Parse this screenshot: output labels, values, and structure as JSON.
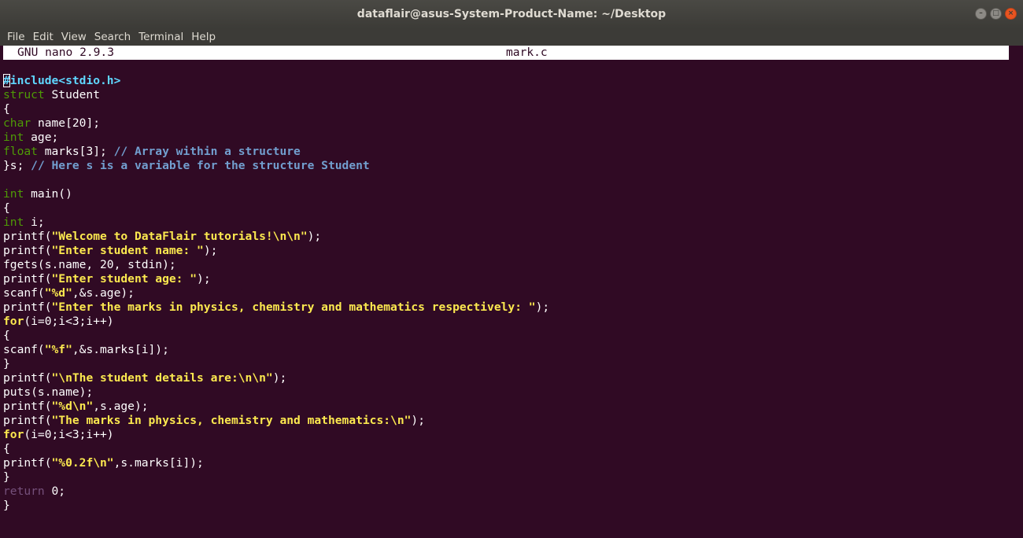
{
  "window": {
    "title": "dataflair@asus-System-Product-Name: ~/Desktop",
    "controls": {
      "minimize": "–",
      "maximize": "□",
      "close": "×"
    }
  },
  "menu": {
    "items": [
      "File",
      "Edit",
      "View",
      "Search",
      "Terminal",
      "Help"
    ]
  },
  "nano": {
    "version": "GNU nano 2.9.3",
    "filename": "mark.c"
  },
  "colors": {
    "terminal_background": "#300a24",
    "titlebar": "#3c3b37",
    "keyword": "#4e9a06",
    "preprocessor": "#5fd7ff",
    "comment": "#729fcf",
    "string": "#fce94f",
    "close_button": "#e95420"
  },
  "code": {
    "lines": [
      [
        {
          "t": "#",
          "c": "cursor-pre"
        },
        {
          "t": "include<stdio.h>",
          "c": "pre"
        }
      ],
      [
        {
          "t": "struct",
          "c": "keyword"
        },
        {
          "t": " Student",
          "c": "plain"
        }
      ],
      [
        {
          "t": "{",
          "c": "plain"
        }
      ],
      [
        {
          "t": "char",
          "c": "keyword"
        },
        {
          "t": " name[20];",
          "c": "plain"
        }
      ],
      [
        {
          "t": "int",
          "c": "keyword"
        },
        {
          "t": " age;",
          "c": "plain"
        }
      ],
      [
        {
          "t": "float",
          "c": "keyword"
        },
        {
          "t": " marks[3]; ",
          "c": "plain"
        },
        {
          "t": "// Array within a structure",
          "c": "comment"
        }
      ],
      [
        {
          "t": "}s; ",
          "c": "plain"
        },
        {
          "t": "// Here s is a variable for the structure Student",
          "c": "comment"
        }
      ],
      [],
      [
        {
          "t": "int",
          "c": "keyword"
        },
        {
          "t": " main()",
          "c": "plain"
        }
      ],
      [
        {
          "t": "{",
          "c": "plain"
        }
      ],
      [
        {
          "t": "int",
          "c": "keyword"
        },
        {
          "t": " i;",
          "c": "plain"
        }
      ],
      [
        {
          "t": "printf(",
          "c": "plain"
        },
        {
          "t": "\"Welcome to DataFlair tutorials!\\n\\n\"",
          "c": "string"
        },
        {
          "t": ");",
          "c": "plain"
        }
      ],
      [
        {
          "t": "printf(",
          "c": "plain"
        },
        {
          "t": "\"Enter student name: \"",
          "c": "string"
        },
        {
          "t": ");",
          "c": "plain"
        }
      ],
      [
        {
          "t": "fgets(s.name, 20, stdin);",
          "c": "plain"
        }
      ],
      [
        {
          "t": "printf(",
          "c": "plain"
        },
        {
          "t": "\"Enter student age: \"",
          "c": "string"
        },
        {
          "t": ");",
          "c": "plain"
        }
      ],
      [
        {
          "t": "scanf(",
          "c": "plain"
        },
        {
          "t": "\"%d\"",
          "c": "string"
        },
        {
          "t": ",&s.age);",
          "c": "plain"
        }
      ],
      [
        {
          "t": "printf(",
          "c": "plain"
        },
        {
          "t": "\"Enter the marks in physics, chemistry and mathematics respectively: \"",
          "c": "string"
        },
        {
          "t": ");",
          "c": "plain"
        }
      ],
      [
        {
          "t": "for",
          "c": "flow"
        },
        {
          "t": "(i=0;i<3;i++)",
          "c": "plain"
        }
      ],
      [
        {
          "t": "{",
          "c": "plain"
        }
      ],
      [
        {
          "t": "scanf(",
          "c": "plain"
        },
        {
          "t": "\"%f\"",
          "c": "string"
        },
        {
          "t": ",&s.marks[i]);",
          "c": "plain"
        }
      ],
      [
        {
          "t": "}",
          "c": "plain"
        }
      ],
      [
        {
          "t": "printf(",
          "c": "plain"
        },
        {
          "t": "\"\\nThe student details are:\\n\\n\"",
          "c": "string"
        },
        {
          "t": ");",
          "c": "plain"
        }
      ],
      [
        {
          "t": "puts(s.name);",
          "c": "plain"
        }
      ],
      [
        {
          "t": "printf(",
          "c": "plain"
        },
        {
          "t": "\"%d\\n\"",
          "c": "string"
        },
        {
          "t": ",s.age);",
          "c": "plain"
        }
      ],
      [
        {
          "t": "printf(",
          "c": "plain"
        },
        {
          "t": "\"The marks in physics, chemistry and mathematics:\\n\"",
          "c": "string"
        },
        {
          "t": ");",
          "c": "plain"
        }
      ],
      [
        {
          "t": "for",
          "c": "flow"
        },
        {
          "t": "(i=0;i<3;i++)",
          "c": "plain"
        }
      ],
      [
        {
          "t": "{",
          "c": "plain"
        }
      ],
      [
        {
          "t": "printf(",
          "c": "plain"
        },
        {
          "t": "\"%0.2f\\n\"",
          "c": "string"
        },
        {
          "t": ",s.marks[i]);",
          "c": "plain"
        }
      ],
      [
        {
          "t": "}",
          "c": "plain"
        }
      ],
      [
        {
          "t": "return",
          "c": "return"
        },
        {
          "t": " 0;",
          "c": "plain"
        }
      ],
      [
        {
          "t": "}",
          "c": "plain"
        }
      ]
    ]
  }
}
